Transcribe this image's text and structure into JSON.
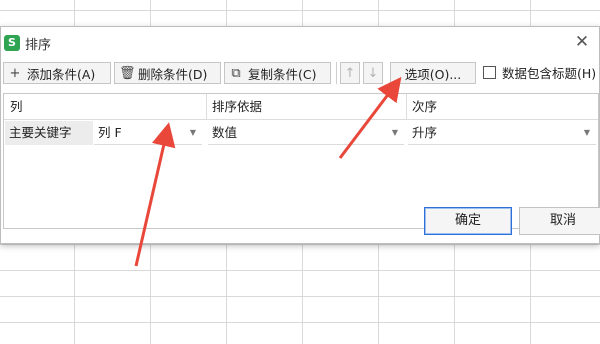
{
  "dialog": {
    "app_icon_glyph": "S",
    "title": "排序",
    "close_glyph": "✕"
  },
  "toolbar": {
    "add_icon": "+",
    "add_label": "添加条件(A)",
    "delete_icon": "🗑",
    "delete_label": "删除条件(D)",
    "copy_icon": "⧉",
    "copy_label": "复制条件(C)",
    "up_glyph": "↑",
    "down_glyph": "↓",
    "options_label": "选项(O)...",
    "header_checkbox_label": "数据包含标题(H)",
    "header_checkbox_checked": false
  },
  "table": {
    "headers": [
      "列",
      "排序依据",
      "次序"
    ],
    "row": {
      "label": "主要关键字",
      "column_value": "列 F",
      "basis_value": "数值",
      "order_value": "升序",
      "caret": "▼"
    }
  },
  "buttons": {
    "ok_label": "确定",
    "cancel_label": "取消"
  },
  "annotation_color": "#e8473a"
}
